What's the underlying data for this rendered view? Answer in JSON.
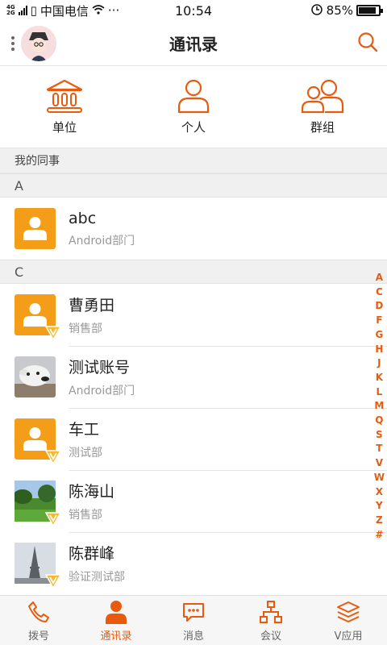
{
  "status": {
    "carrier": "中国电信",
    "network": "4G/2G",
    "time": "10:54",
    "battery": "85%"
  },
  "header": {
    "title": "通讯录",
    "avatar_icon": "avatar-image",
    "search_icon": "search-icon"
  },
  "categories": [
    {
      "label": "单位",
      "icon": "institution-icon"
    },
    {
      "label": "个人",
      "icon": "person-icon"
    },
    {
      "label": "群组",
      "icon": "group-icon"
    }
  ],
  "section_mine": "我的同事",
  "groups": [
    {
      "letter": "A",
      "contacts": [
        {
          "name": "abc",
          "dept": "Android部门"
        }
      ]
    },
    {
      "letter": "C",
      "contacts": [
        {
          "name": "曹勇田",
          "dept": "销售部"
        },
        {
          "name": "测试账号",
          "dept": "Android部门"
        },
        {
          "name": "车工",
          "dept": "测试部"
        },
        {
          "name": "陈海山",
          "dept": "销售部"
        },
        {
          "name": "陈群峰",
          "dept": "验证测试部"
        }
      ]
    }
  ],
  "alphabet": [
    "A",
    "C",
    "D",
    "F",
    "G",
    "H",
    "J",
    "K",
    "L",
    "M",
    "Q",
    "S",
    "T",
    "V",
    "W",
    "X",
    "Y",
    "Z",
    "#"
  ],
  "tabs": [
    {
      "label": "拨号",
      "icon": "phone-icon"
    },
    {
      "label": "通讯录",
      "icon": "contacts-icon",
      "active": true
    },
    {
      "label": "消息",
      "icon": "message-icon"
    },
    {
      "label": "会议",
      "icon": "meeting-icon"
    },
    {
      "label": "V应用",
      "icon": "apps-icon"
    }
  ],
  "colors": {
    "accent": "#e85b0f",
    "avatar_orange": "#f49d18"
  }
}
